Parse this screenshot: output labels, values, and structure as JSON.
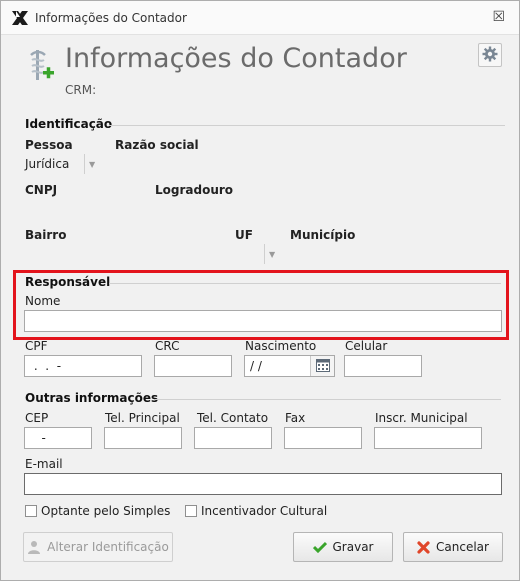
{
  "window": {
    "title": "Informações do Contador",
    "close_symbol": "☒"
  },
  "header": {
    "title": "Informações do Contador",
    "crm_label": "CRM:",
    "icon": "medical-caduceus-add-icon",
    "settings_icon": "gear-icon"
  },
  "identificacao": {
    "section_title": "Identificação",
    "pessoa_label": "Pessoa",
    "pessoa_value": "Jurídica",
    "razao_social_label": "Razão social",
    "cnpj_label": "CNPJ",
    "logradouro_label": "Logradouro",
    "bairro_label": "Bairro",
    "uf_label": "UF",
    "municipio_label": "Município"
  },
  "responsavel": {
    "section_title": "Responsável",
    "nome_label": "Nome",
    "nome_value": "",
    "cpf_label": "CPF",
    "cpf_value": " .  .  -",
    "crc_label": "CRC",
    "crc_value": "",
    "nascimento_label": "Nascimento",
    "nascimento_value": "/ /",
    "celular_label": "Celular",
    "celular_value": ""
  },
  "outras": {
    "section_title": "Outras informações",
    "cep_label": "CEP",
    "cep_value": "   -",
    "tel_principal_label": "Tel. Principal",
    "tel_contato_label": "Tel. Contato",
    "fax_label": "Fax",
    "inscr_municipal_label": "Inscr. Municipal",
    "email_label": "E-mail",
    "email_value": ""
  },
  "options": {
    "optante_simples_label": "Optante pelo Simples",
    "optante_simples_checked": false,
    "incentivador_cultural_label": "Incentivador Cultural",
    "incentivador_cultural_checked": false
  },
  "buttons": {
    "alterar_label": "Alterar Identificação",
    "gravar_label": "Gravar",
    "cancelar_label": "Cancelar"
  },
  "colors": {
    "highlight": "#e3141c",
    "check_green": "#3aa52c",
    "cancel_red": "#e0462a"
  }
}
